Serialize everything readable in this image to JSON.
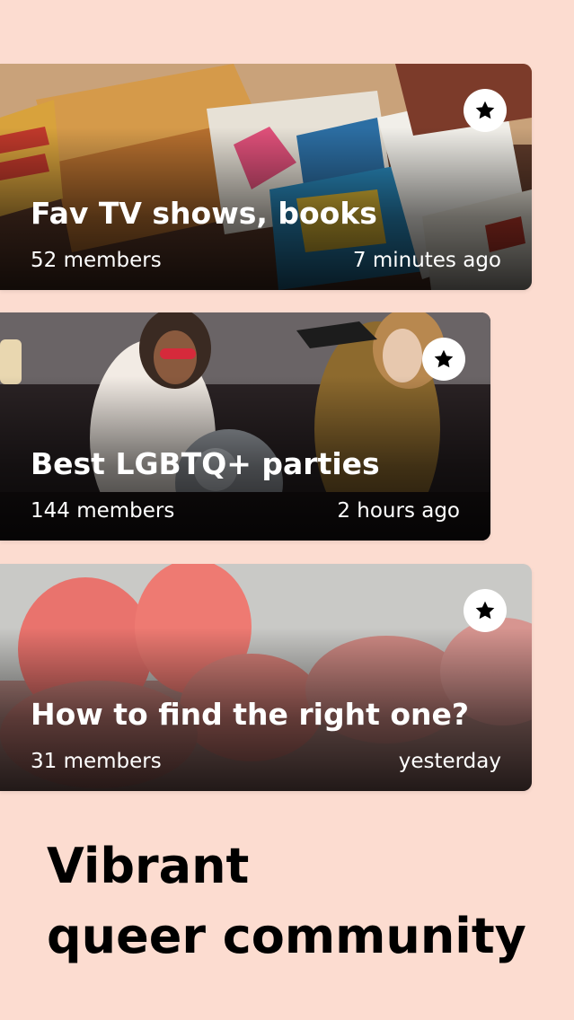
{
  "groups": [
    {
      "title": "Fav TV shows, books",
      "members": "52 members",
      "time": "7 minutes ago"
    },
    {
      "title": "Best LGBTQ+ parties",
      "members": "144 members",
      "time": "2 hours ago"
    },
    {
      "title": "How to find the right one?",
      "members": "31 members",
      "time": "yesterday"
    }
  ],
  "tagline": {
    "line1": "Vibrant",
    "line2": "queer community"
  },
  "colors": {
    "background": "#fcdcd0",
    "card_text": "#ffffff",
    "tagline": "#000000"
  },
  "icons": {
    "favorite": "star-icon"
  }
}
